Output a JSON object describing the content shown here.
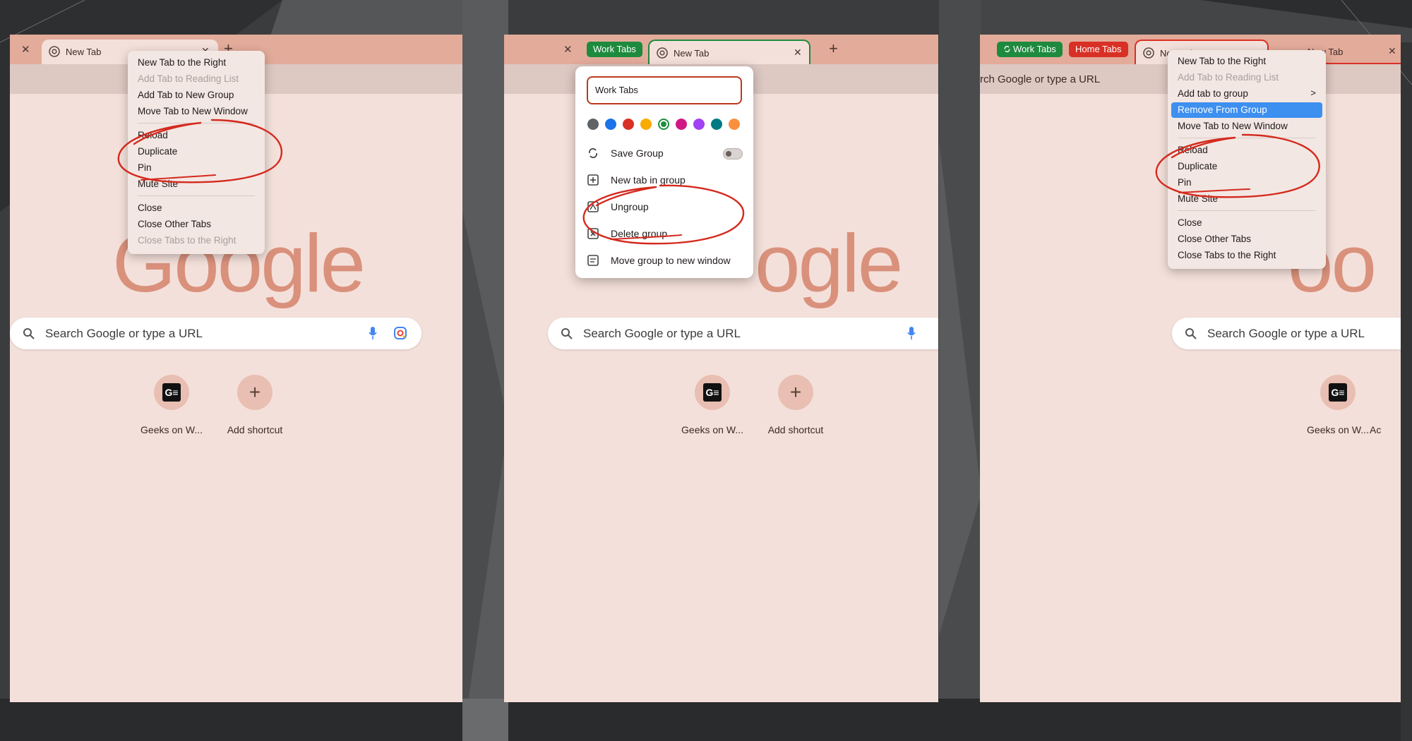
{
  "panel1": {
    "tab_title": "New Tab",
    "context_menu": [
      {
        "label": "New Tab to the Right",
        "disabled": false
      },
      {
        "label": "Add Tab to Reading List",
        "disabled": true
      },
      {
        "label": "Add Tab to New Group",
        "disabled": false
      },
      {
        "label": "Move Tab to New Window",
        "disabled": false
      },
      {
        "label": "Reload",
        "disabled": false
      },
      {
        "label": "Duplicate",
        "disabled": false
      },
      {
        "label": "Pin",
        "disabled": false
      },
      {
        "label": "Mute Site",
        "disabled": false
      },
      {
        "label": "Close",
        "disabled": false
      },
      {
        "label": "Close Other Tabs",
        "disabled": false
      },
      {
        "label": "Close Tabs to the Right",
        "disabled": true
      }
    ],
    "logo": "Google",
    "search_placeholder": "Search Google or type a URL",
    "shortcuts": [
      {
        "label": "Geeks on W...",
        "icon": "G≡"
      },
      {
        "label": "Add shortcut",
        "icon": "+"
      }
    ]
  },
  "panel2": {
    "group_chip": "Work Tabs",
    "group_color": "#1e8a3e",
    "tab_title": "New Tab",
    "group_name_value": "Work Tabs",
    "colors": [
      "#5f6368",
      "#1a73e8",
      "#d93025",
      "#f9ab00",
      "#1e8e3e",
      "#d01884",
      "#a142f4",
      "#007b83",
      "#fa903e"
    ],
    "group_menu": [
      {
        "label": "Save Group",
        "icon": "save-group-icon"
      },
      {
        "label": "New tab in group",
        "icon": "new-tab-in-group-icon"
      },
      {
        "label": "Ungroup",
        "icon": "ungroup-icon"
      },
      {
        "label": "Delete group",
        "icon": "delete-group-icon"
      },
      {
        "label": "Move group to new window",
        "icon": "move-group-icon"
      }
    ],
    "logo": "ogle",
    "search_placeholder": "Search Google or type a URL",
    "shortcuts": [
      {
        "label": "Geeks on W...",
        "icon": "G≡"
      },
      {
        "label": "Add shortcut",
        "icon": "+"
      }
    ]
  },
  "panel3": {
    "group_chips": [
      {
        "label": "Work Tabs",
        "color": "#1e8a3e"
      },
      {
        "label": "Home Tabs",
        "color": "#d93025"
      }
    ],
    "tab_title": "New Tab",
    "tab_title_2": "New Tab",
    "address_text": "rch Google or type a URL",
    "context_menu": [
      {
        "label": "New Tab to the Right",
        "disabled": false
      },
      {
        "label": "Add Tab to Reading List",
        "disabled": true
      },
      {
        "label": "Add tab to group",
        "disabled": false
      },
      {
        "label": "Remove From Group",
        "disabled": false,
        "highlighted": true
      },
      {
        "label": "Move Tab to New Window",
        "disabled": false
      },
      {
        "label": "Reload",
        "disabled": false
      },
      {
        "label": "Duplicate",
        "disabled": false
      },
      {
        "label": "Pin",
        "disabled": false
      },
      {
        "label": "Mute Site",
        "disabled": false
      },
      {
        "label": "Close",
        "disabled": false
      },
      {
        "label": "Close Other Tabs",
        "disabled": false
      },
      {
        "label": "Close Tabs to the Right",
        "disabled": false
      }
    ],
    "submenu_arrow": ">",
    "logo": "oo",
    "search_placeholder": "Search Google or type a URL",
    "shortcuts": [
      {
        "label": "Geeks on W...",
        "icon": "G≡"
      },
      {
        "label": "Ac",
        "icon": "+"
      }
    ]
  },
  "colors": {
    "tabstrip": "#e3ab9a",
    "page_bg": "#f4e0da",
    "annotation_red": "#d42a1e",
    "highlight_blue": "#3d8ff0"
  }
}
